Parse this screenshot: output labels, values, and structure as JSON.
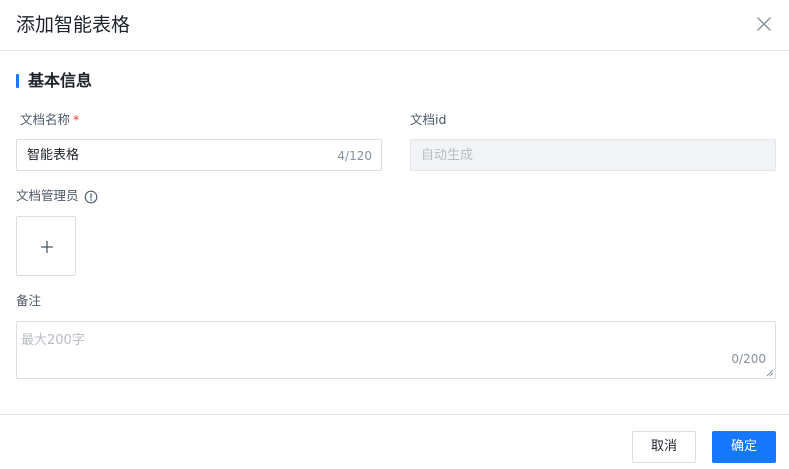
{
  "dialog": {
    "title": "添加智能表格",
    "close_icon": "close-icon"
  },
  "section": {
    "title": "基本信息",
    "accent_color": "#1677ff"
  },
  "form": {
    "doc_name": {
      "label": "文档名称",
      "required_mark": "*",
      "value": "智能表格",
      "count": "4/120"
    },
    "doc_id": {
      "label": "文档id",
      "placeholder": "自动生成"
    },
    "admin": {
      "label": "文档管理员",
      "info_icon": "info-circle-icon",
      "add_icon": "plus-icon"
    },
    "remark": {
      "label": "备注",
      "placeholder": "最大200字",
      "count": "0/200"
    }
  },
  "footer": {
    "cancel_label": "取消",
    "confirm_label": "确定",
    "primary_color": "#1677ff"
  }
}
